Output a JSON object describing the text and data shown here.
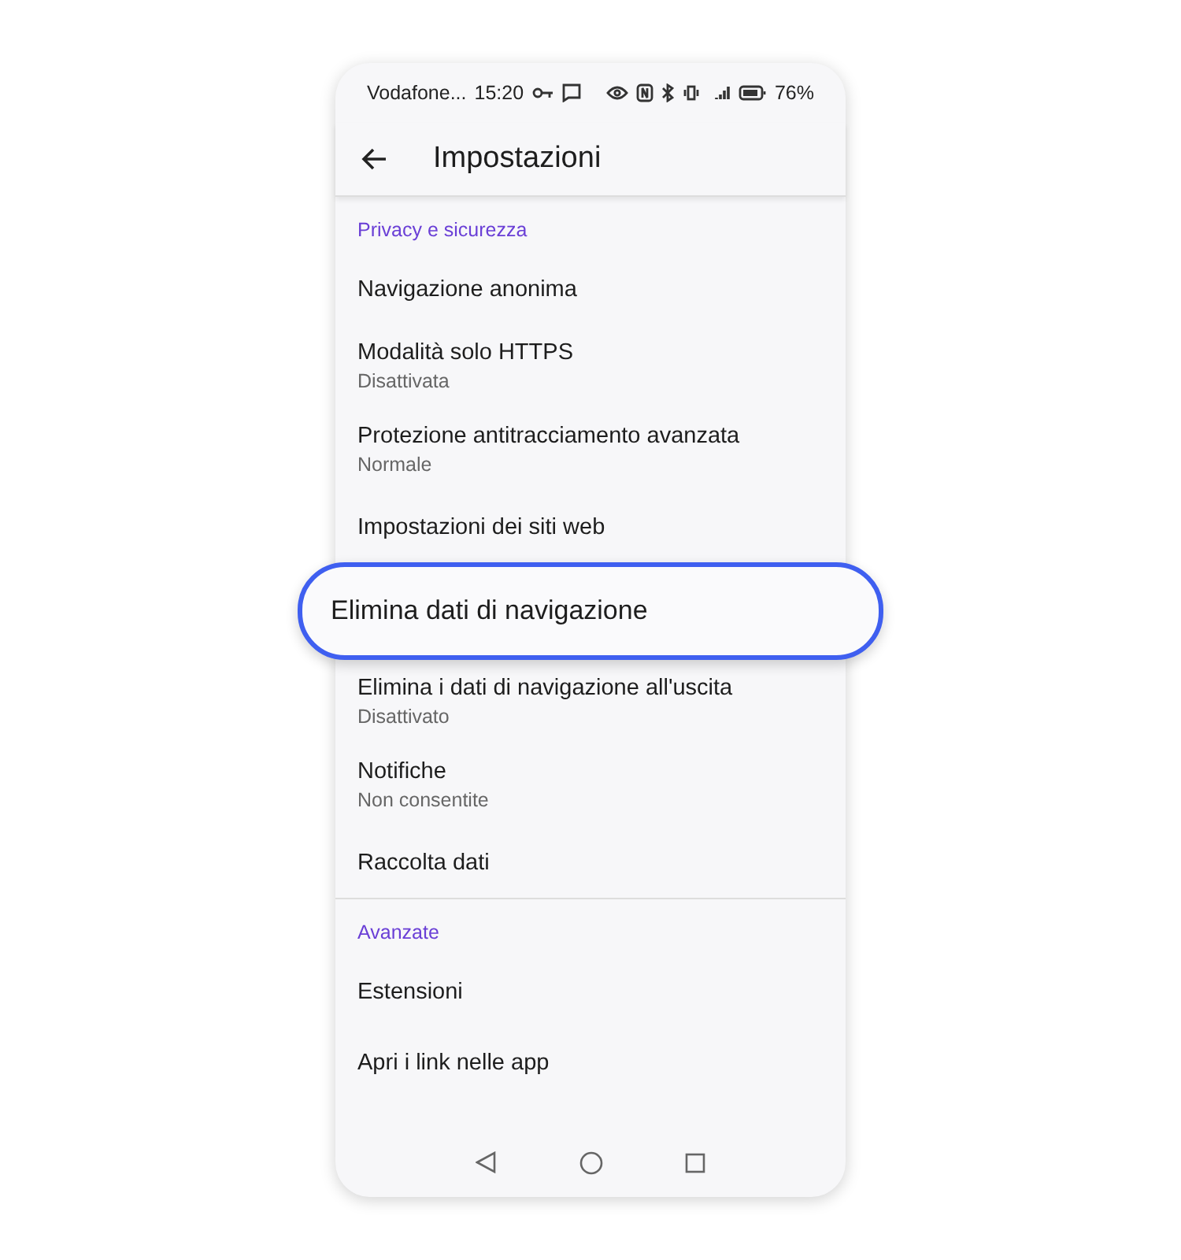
{
  "status_bar": {
    "carrier": "Vodafone...",
    "time": "15:20",
    "battery": "76%"
  },
  "app_bar": {
    "title": "Impostazioni"
  },
  "sections": [
    {
      "header": "Privacy e sicurezza",
      "items": [
        {
          "kind": "row",
          "title": "Navigazione anonima"
        },
        {
          "kind": "row",
          "title": "Modalità solo HTTPS",
          "subtitle": "Disattivata"
        },
        {
          "kind": "row",
          "title": "Protezione antitracciamento avanzata",
          "subtitle": "Normale"
        },
        {
          "kind": "row",
          "title": "Impostazioni dei siti web"
        },
        {
          "kind": "highlighted",
          "title": "Elimina dati di navigazione"
        },
        {
          "kind": "row",
          "title": "Elimina i dati di navigazione all'uscita",
          "subtitle": "Disattivato"
        },
        {
          "kind": "row",
          "title": "Notifiche",
          "subtitle": "Non consentite"
        },
        {
          "kind": "row",
          "title": "Raccolta dati"
        }
      ]
    },
    {
      "header": "Avanzate",
      "items": [
        {
          "kind": "row",
          "title": "Estensioni"
        },
        {
          "kind": "row",
          "title": "Apri i link nelle app"
        }
      ]
    }
  ]
}
